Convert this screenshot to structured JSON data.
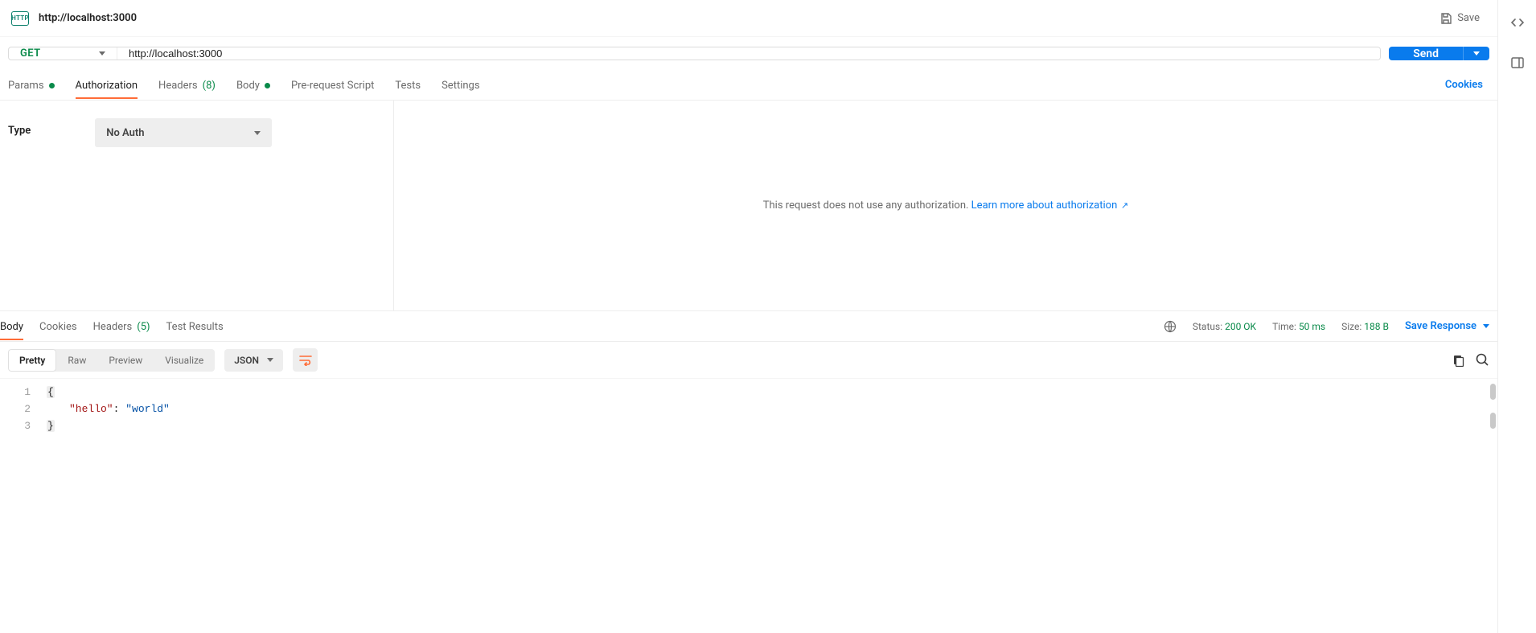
{
  "title": {
    "badge": "HTTP",
    "name": "http://localhost:3000",
    "save_label": "Save"
  },
  "request": {
    "method": "GET",
    "url": "http://localhost:3000",
    "send_label": "Send"
  },
  "req_tabs": {
    "params": "Params",
    "authorization": "Authorization",
    "headers": "Headers",
    "headers_count": "(8)",
    "body": "Body",
    "prerequest": "Pre-request Script",
    "tests": "Tests",
    "settings": "Settings",
    "cookies": "Cookies"
  },
  "auth": {
    "type_label": "Type",
    "selected": "No Auth",
    "msg_text": "This request does not use any authorization. ",
    "link_text": "Learn more about authorization"
  },
  "resp_tabs": {
    "body": "Body",
    "cookies": "Cookies",
    "headers": "Headers",
    "headers_count": "(5)",
    "test_results": "Test Results"
  },
  "stats": {
    "status_label": "Status:",
    "status_val": "200 OK",
    "time_label": "Time:",
    "time_val": "50 ms",
    "size_label": "Size:",
    "size_val": "188 B",
    "save_response": "Save Response"
  },
  "viewer": {
    "pretty": "Pretty",
    "raw": "Raw",
    "preview": "Preview",
    "visualize": "Visualize",
    "format": "JSON"
  },
  "code": {
    "line1_num": "1",
    "line2_num": "2",
    "line3_num": "3",
    "brace_open": "{",
    "brace_close": "}",
    "key": "\"hello\"",
    "colon": ": ",
    "value": "\"world\""
  }
}
